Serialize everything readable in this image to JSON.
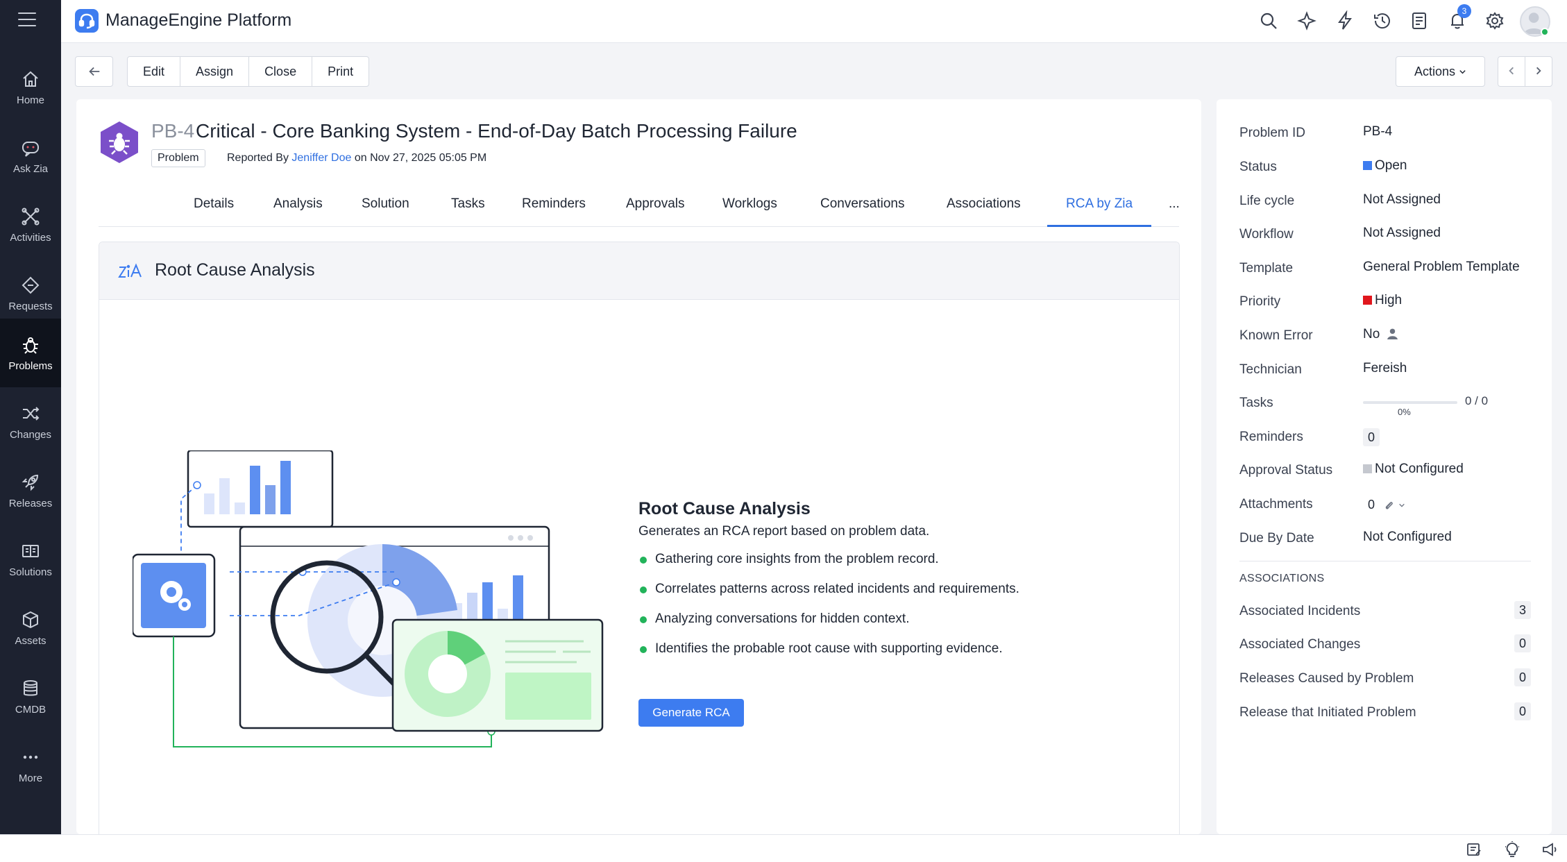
{
  "app": {
    "title": "ManageEngine Platform"
  },
  "sidebar": {
    "items": [
      {
        "label": "Home",
        "icon": "home-icon"
      },
      {
        "label": "Ask Zia",
        "icon": "zia-chat-icon"
      },
      {
        "label": "Activities",
        "icon": "activities-icon"
      },
      {
        "label": "Requests",
        "icon": "requests-icon"
      },
      {
        "label": "Problems",
        "icon": "problems-icon",
        "active": true
      },
      {
        "label": "Changes",
        "icon": "changes-icon"
      },
      {
        "label": "Releases",
        "icon": "releases-icon"
      },
      {
        "label": "Solutions",
        "icon": "solutions-icon"
      },
      {
        "label": "Assets",
        "icon": "assets-icon"
      },
      {
        "label": "CMDB",
        "icon": "cmdb-icon"
      },
      {
        "label": "More",
        "icon": "more-icon"
      }
    ]
  },
  "topbar": {
    "notifications_count": "3"
  },
  "toolbar": {
    "edit": "Edit",
    "assign": "Assign",
    "close": "Close",
    "print": "Print",
    "actions": "Actions"
  },
  "problem": {
    "id": "PB-4",
    "title": "Critical - Core Banking System - End-of-Day Batch Processing Failure",
    "type": "Problem",
    "reported_prefix": "Reported By",
    "reported_by": "Jeniffer Doe",
    "reported_on": "on Nov 27, 2025 05:05 PM"
  },
  "tabs": [
    "Details",
    "Analysis",
    "Solution",
    "Tasks",
    "Reminders",
    "Approvals",
    "Worklogs",
    "Conversations",
    "Associations",
    "RCA by Zia",
    "..."
  ],
  "rca": {
    "header": "Root Cause Analysis",
    "title": "Root Cause Analysis",
    "subtitle": "Generates an RCA report based on problem data.",
    "points": [
      "Gathering core insights from the problem record.",
      "Correlates patterns across related incidents and requirements.",
      "Analyzing conversations for hidden context.",
      "Identifies the probable root cause with supporting evidence."
    ],
    "button": "Generate RCA"
  },
  "properties": {
    "problem_id": {
      "label": "Problem ID",
      "value": "PB-4"
    },
    "status": {
      "label": "Status",
      "value": "Open",
      "color": "#3d7cf0"
    },
    "lifecycle": {
      "label": "Life cycle",
      "value": "Not Assigned"
    },
    "workflow": {
      "label": "Workflow",
      "value": "Not Assigned"
    },
    "template": {
      "label": "Template",
      "value": "General Problem Template"
    },
    "priority": {
      "label": "Priority",
      "value": "High",
      "color": "#e0161c"
    },
    "known_error": {
      "label": "Known Error",
      "value": "No"
    },
    "technician": {
      "label": "Technician",
      "value": "Fereish"
    },
    "tasks": {
      "label": "Tasks",
      "percent": "0%",
      "count": "0 / 0",
      "progress": 0
    },
    "reminders": {
      "label": "Reminders",
      "value": "0"
    },
    "approval_status": {
      "label": "Approval Status",
      "value": "Not Configured",
      "color": "#c5c8cf"
    },
    "attachments": {
      "label": "Attachments",
      "value": "0"
    },
    "due_by": {
      "label": "Due By Date",
      "value": "Not Configured"
    }
  },
  "associations": {
    "heading": "ASSOCIATIONS",
    "rows": [
      {
        "label": "Associated Incidents",
        "value": "3"
      },
      {
        "label": "Associated Changes",
        "value": "0"
      },
      {
        "label": "Releases Caused by Problem",
        "value": "0"
      },
      {
        "label": "Release that Initiated Problem",
        "value": "0"
      }
    ]
  }
}
